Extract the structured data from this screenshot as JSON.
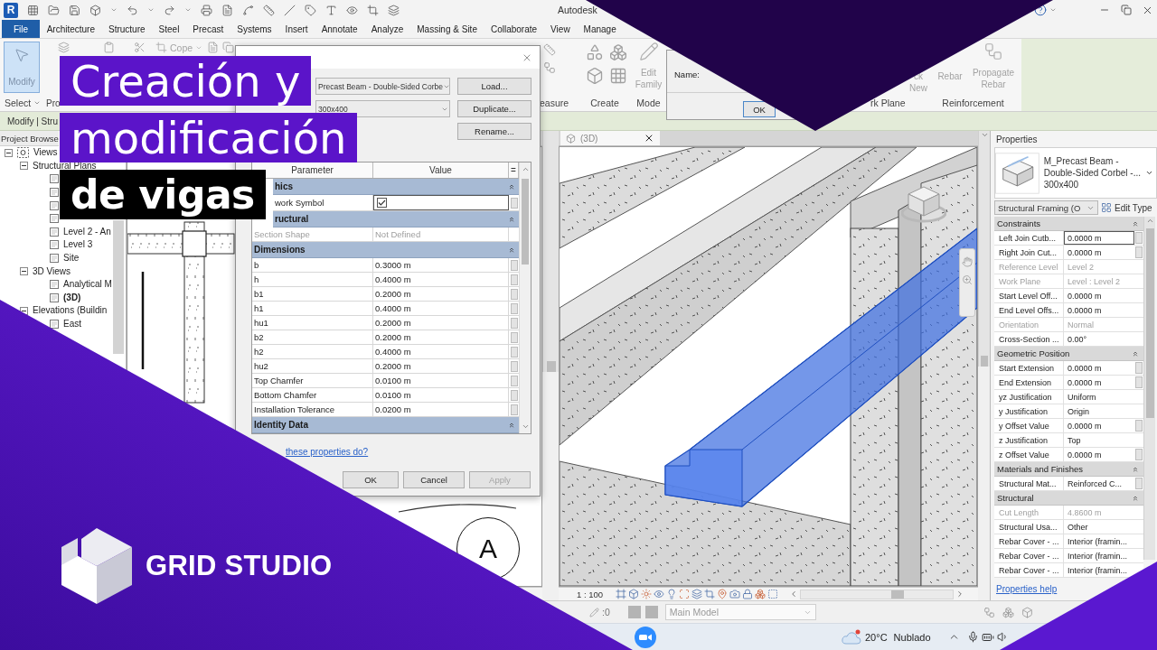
{
  "title_bar": {
    "app_logo": "R",
    "title": "Autodesk"
  },
  "ribbon_tabs": [
    {
      "label": "File",
      "selected": true
    },
    {
      "label": "Architecture",
      "selected": false
    },
    {
      "label": "Structure",
      "selected": false
    },
    {
      "label": "Steel",
      "selected": false
    },
    {
      "label": "Precast",
      "selected": false
    },
    {
      "label": "Systems",
      "selected": false
    },
    {
      "label": "Insert",
      "selected": false
    },
    {
      "label": "Annotate",
      "selected": false
    },
    {
      "label": "Analyze",
      "selected": false
    },
    {
      "label": "Massing & Site",
      "selected": false
    },
    {
      "label": "Collaborate",
      "selected": false
    },
    {
      "label": "View",
      "selected": false
    },
    {
      "label": "Manage",
      "selected": false
    }
  ],
  "ribbon": {
    "modify_tool": {
      "label": "Modify",
      "selected": true
    },
    "cope_tool": {
      "label": "Cope",
      "disabled": true
    },
    "panel_labels_left": [
      "Select",
      "Pro"
    ],
    "tools_right": [
      {
        "label": "Edit Family",
        "disabled": true
      },
      {
        "label": "ck New",
        "disabled": true
      },
      {
        "label": "Rebar",
        "disabled": true
      },
      {
        "label": "Propagate Rebar",
        "disabled": true
      }
    ],
    "panel_labels_right": [
      "easure",
      "Create",
      "Mode",
      "rk Plane",
      "Reinforcement"
    ]
  },
  "context_bar": {
    "text": "Modify | Stru"
  },
  "name_dialog": {
    "label": "Name:",
    "ok_button": "OK"
  },
  "project_browser": {
    "title": "Project Browse",
    "tree": [
      {
        "label": "Views",
        "expanded": true,
        "children": [
          {
            "label": "Structural Plans",
            "expanded": true,
            "children": [
              {
                "selected": false
              },
              {
                "selected": false
              },
              {
                "selected": false
              },
              {
                "selected": false
              },
              {
                "label": "Level 2 - An",
                "selected": false
              },
              {
                "label": "Level 3",
                "selected": false
              },
              {
                "label": "Site",
                "selected": false
              }
            ]
          },
          {
            "label": "3D Views",
            "expanded": true,
            "children": [
              {
                "label": "Analytical M",
                "selected": false
              },
              {
                "label": "(3D)",
                "selected": true
              }
            ]
          },
          {
            "label": "Elevations (Buildin",
            "expanded": true,
            "children": [
              {
                "label": "East",
                "selected": false
              }
            ]
          }
        ]
      }
    ]
  },
  "plan_view": {
    "grid_bubble": "A"
  },
  "type_properties_dialog": {
    "family": "Precast Beam - Double-Sided Corbe",
    "type": "300x400",
    "side_buttons": [
      "Load...",
      "Duplicate...",
      "Rename..."
    ],
    "columns": [
      "Parameter",
      "Value",
      "="
    ],
    "rows": [
      {
        "kind": "group",
        "label": "hics"
      },
      {
        "kind": "checkbox",
        "parameter": "work Symbol",
        "checked": true
      },
      {
        "kind": "group",
        "label": "ructural"
      },
      {
        "kind": "value",
        "parameter": "Section Shape",
        "value": "Not Defined",
        "disabled": true
      },
      {
        "kind": "group",
        "label": "Dimensions"
      },
      {
        "kind": "value",
        "parameter": "b",
        "value": "0.3000 m",
        "disabled": false
      },
      {
        "kind": "value",
        "parameter": "h",
        "value": "0.4000 m",
        "disabled": false
      },
      {
        "kind": "value",
        "parameter": "b1",
        "value": "0.2000 m",
        "disabled": false
      },
      {
        "kind": "value",
        "parameter": "h1",
        "value": "0.4000 m",
        "disabled": false
      },
      {
        "kind": "value",
        "parameter": "hu1",
        "value": "0.2000 m",
        "disabled": false
      },
      {
        "kind": "value",
        "parameter": "b2",
        "value": "0.2000 m",
        "disabled": false
      },
      {
        "kind": "value",
        "parameter": "h2",
        "value": "0.4000 m",
        "disabled": false
      },
      {
        "kind": "value",
        "parameter": "hu2",
        "value": "0.2000 m",
        "disabled": false
      },
      {
        "kind": "value",
        "parameter": "Top Chamfer",
        "value": "0.0100 m",
        "disabled": false
      },
      {
        "kind": "value",
        "parameter": "Bottom Chamfer",
        "value": "0.0100 m",
        "disabled": false
      },
      {
        "kind": "value",
        "parameter": "Installation Tolerance",
        "value": "0.0200 m",
        "disabled": false
      },
      {
        "kind": "group",
        "label": "Identity Data"
      }
    ],
    "help_link": "these properties do?",
    "footer_buttons": [
      {
        "label": "OK",
        "disabled": false
      },
      {
        "label": "Cancel",
        "disabled": false
      },
      {
        "label": "Apply",
        "disabled": true
      }
    ]
  },
  "view_3d": {
    "tab": "(3D)",
    "scale": "1 : 100"
  },
  "properties_panel": {
    "title": "Properties",
    "type_family_lines": [
      "M_Precast Beam -",
      "Double-Sided Corbel -..."
    ],
    "type_name": "300x400",
    "instance_filter": "Structural Framing (O",
    "edit_type": "Edit Type",
    "groups": [
      {
        "name": "Constraints",
        "rows": [
          {
            "label": "Left Join Cutb...",
            "value": "0.0000 m",
            "disabled": false,
            "active": true,
            "associate_button": true
          },
          {
            "label": "Right Join Cut...",
            "value": "0.0000 m",
            "disabled": false,
            "active": false,
            "associate_button": true
          },
          {
            "label": "Reference Level",
            "value": "Level 2",
            "disabled": true,
            "active": false,
            "associate_button": false
          },
          {
            "label": "Work Plane",
            "value": "Level : Level 2",
            "disabled": true,
            "active": false,
            "associate_button": false
          },
          {
            "label": "Start Level Off...",
            "value": "0.0000 m",
            "disabled": false,
            "active": false,
            "associate_button": false
          },
          {
            "label": "End Level Offs...",
            "value": "0.0000 m",
            "disabled": false,
            "active": false,
            "associate_button": false
          },
          {
            "label": "Orientation",
            "value": "Normal",
            "disabled": true,
            "active": false,
            "associate_button": false
          },
          {
            "label": "Cross-Section ...",
            "value": "0.00°",
            "disabled": false,
            "active": false,
            "associate_button": false
          }
        ]
      },
      {
        "name": "Geometric Position",
        "rows": [
          {
            "label": "Start Extension",
            "value": "0.0000 m",
            "disabled": false,
            "active": false,
            "associate_button": true
          },
          {
            "label": "End Extension",
            "value": "0.0000 m",
            "disabled": false,
            "active": false,
            "associate_button": true
          },
          {
            "label": "yz Justification",
            "value": "Uniform",
            "disabled": false,
            "active": false,
            "associate_button": false
          },
          {
            "label": "y Justification",
            "value": "Origin",
            "disabled": false,
            "active": false,
            "associate_button": false
          },
          {
            "label": "y Offset Value",
            "value": "0.0000 m",
            "disabled": false,
            "active": false,
            "associate_button": true
          },
          {
            "label": "z Justification",
            "value": "Top",
            "disabled": false,
            "active": false,
            "associate_button": false
          },
          {
            "label": "z Offset Value",
            "value": "0.0000 m",
            "disabled": false,
            "active": false,
            "associate_button": true
          }
        ]
      },
      {
        "name": "Materials and Finishes",
        "rows": [
          {
            "label": "Structural Mat...",
            "value": "Reinforced C...",
            "disabled": false,
            "active": false,
            "associate_button": true
          }
        ]
      },
      {
        "name": "Structural",
        "rows": [
          {
            "label": "Cut Length",
            "value": "4.8600 m",
            "disabled": true,
            "active": false,
            "associate_button": false
          },
          {
            "label": "Structural Usa...",
            "value": "Other",
            "disabled": false,
            "active": false,
            "associate_button": false
          },
          {
            "label": "Rebar Cover - ...",
            "value": "Interior (framin...",
            "disabled": false,
            "active": false,
            "associate_button": false
          },
          {
            "label": "Rebar Cover - ...",
            "value": "Interior (framin...",
            "disabled": false,
            "active": false,
            "associate_button": false
          },
          {
            "label": "Rebar Cover - ...",
            "value": "Interior (framin...",
            "disabled": false,
            "active": false,
            "associate_button": false
          }
        ]
      }
    ],
    "help_link": "Properties help"
  },
  "status_bar": {
    "counter": ":0",
    "model": "Main Model"
  },
  "taskbar": {
    "temperature": "20°C",
    "weather": "Nublado"
  },
  "thumbnail_title": [
    {
      "text": "Creación y",
      "kind": "title",
      "color": "#5b14c9"
    },
    {
      "text": "modificación",
      "kind": "title",
      "color": "#5b14c9"
    },
    {
      "text": "de vigas",
      "kind": "tag",
      "color": "#000000"
    }
  ],
  "brand": {
    "name": "GRID STUDIO"
  }
}
